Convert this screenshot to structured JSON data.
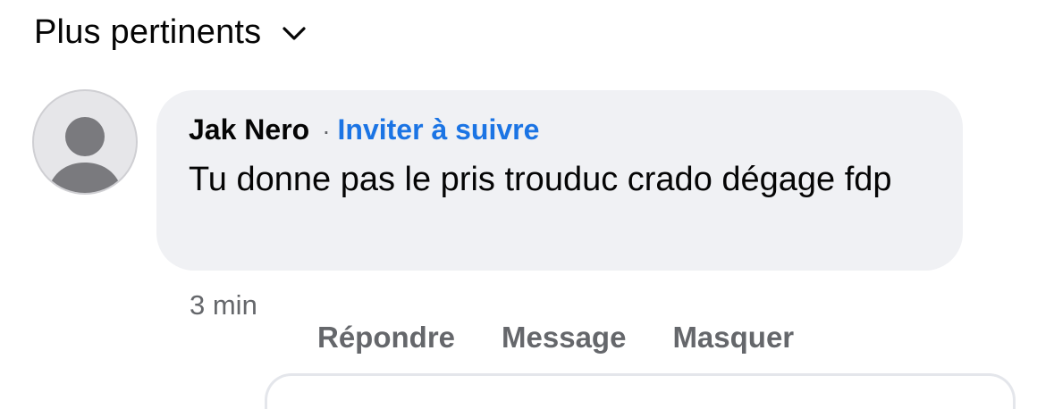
{
  "sort": {
    "label": "Plus pertinents",
    "icon": "chevron-down-icon"
  },
  "comment": {
    "avatar_icon": "default-avatar-icon",
    "author": "Jak Nero",
    "separator": "·",
    "follow_label": "Inviter à suivre",
    "text": "Tu donne pas le pris trouduc crado dégage fdp",
    "timestamp": "3 min",
    "actions": {
      "reply": "Répondre",
      "message": "Message",
      "hide": "Masquer"
    }
  },
  "colors": {
    "link": "#1b74e4",
    "bubble": "#f0f1f4",
    "secondary_text": "#65676b"
  }
}
